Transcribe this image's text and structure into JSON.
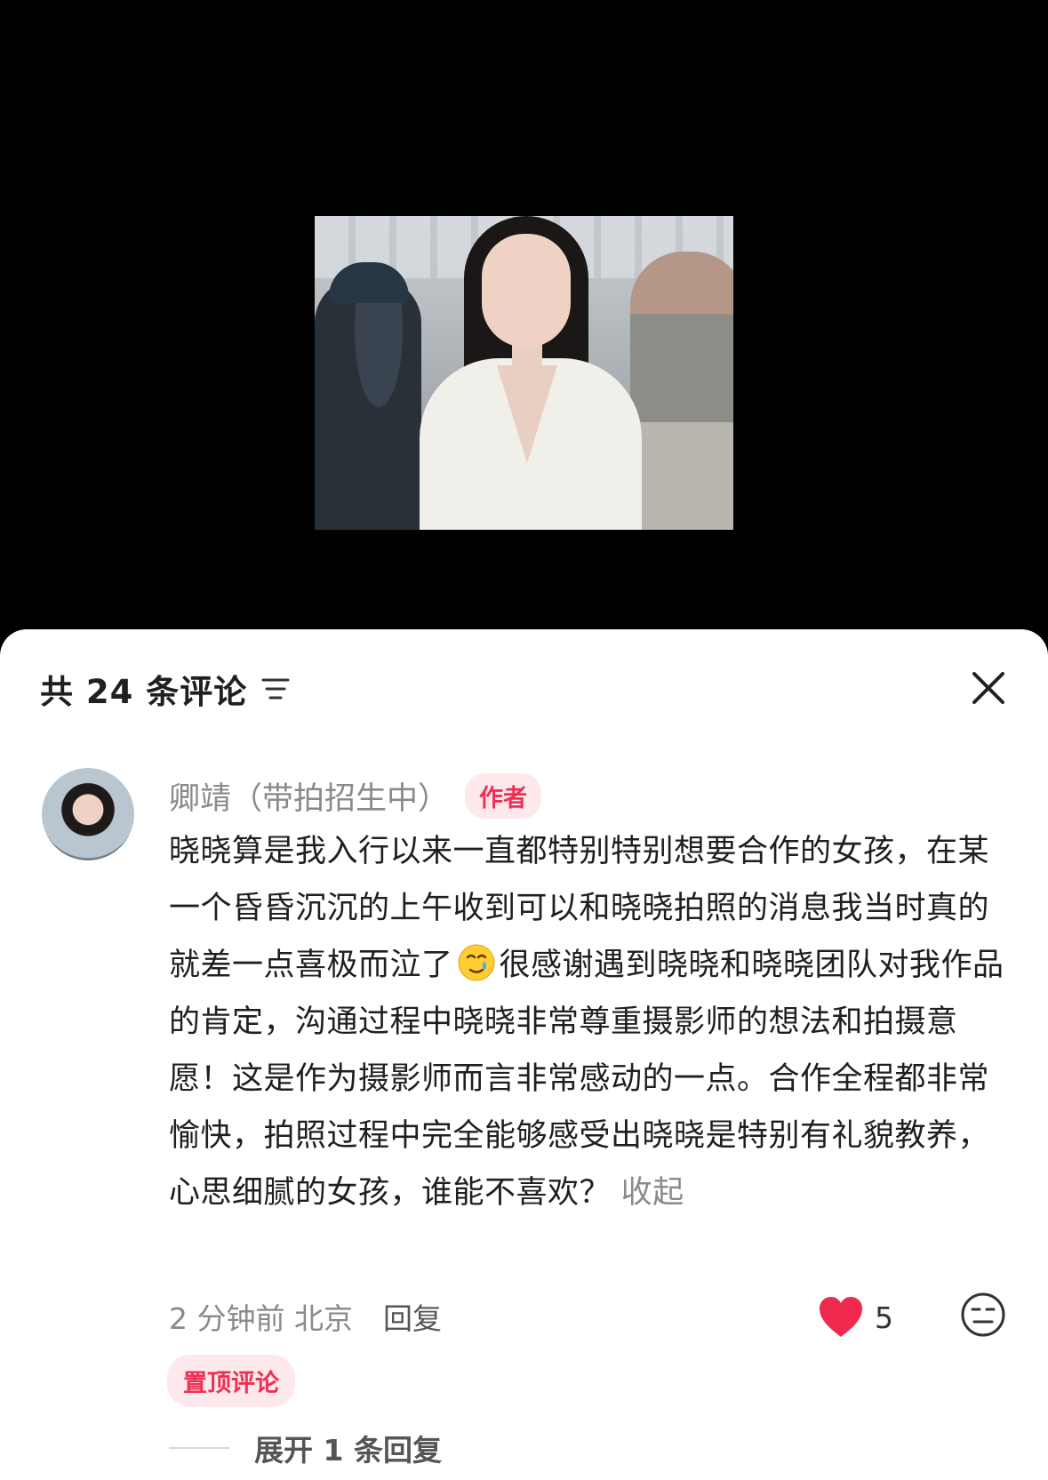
{
  "header": {
    "comment_count_label": "共 24 条评论"
  },
  "comment": {
    "author": "卿靖（带拍招生中）",
    "author_badge": "作者",
    "text_part1": "晓晓算是我入行以来一直都特别特别想要合作的女孩，在某一个昏昏沉沉的上午收到可以和晓晓拍照的消息我当时真的就差一点喜极而泣了",
    "emoji": "tear-smile-emoji",
    "text_part2": "很感谢遇到晓晓和晓晓团队对我作品的肯定，沟通过程中晓晓非常尊重摄影师的想法和拍摄意愿！这是作为摄影师而言非常感动的一点。合作全程都非常愉快，拍照过程中完全能够感受出晓晓是特别有礼貌教养，心思细腻的女孩，谁能不喜欢？",
    "collapse_label": "收起",
    "time_location": "2 分钟前  北京",
    "reply_label": "回复",
    "like_count": "5",
    "pinned_label": "置顶评论",
    "expand_replies_label": "展开 1 条回复"
  },
  "icons": {
    "filter": "filter-lines-icon",
    "close": "close-icon",
    "like": "heart-icon",
    "dislike": "neutral-face-icon"
  },
  "colors": {
    "accent": "#ef2f53",
    "badge_bg": "#fde9ec",
    "muted_text": "#8a8a8a"
  }
}
